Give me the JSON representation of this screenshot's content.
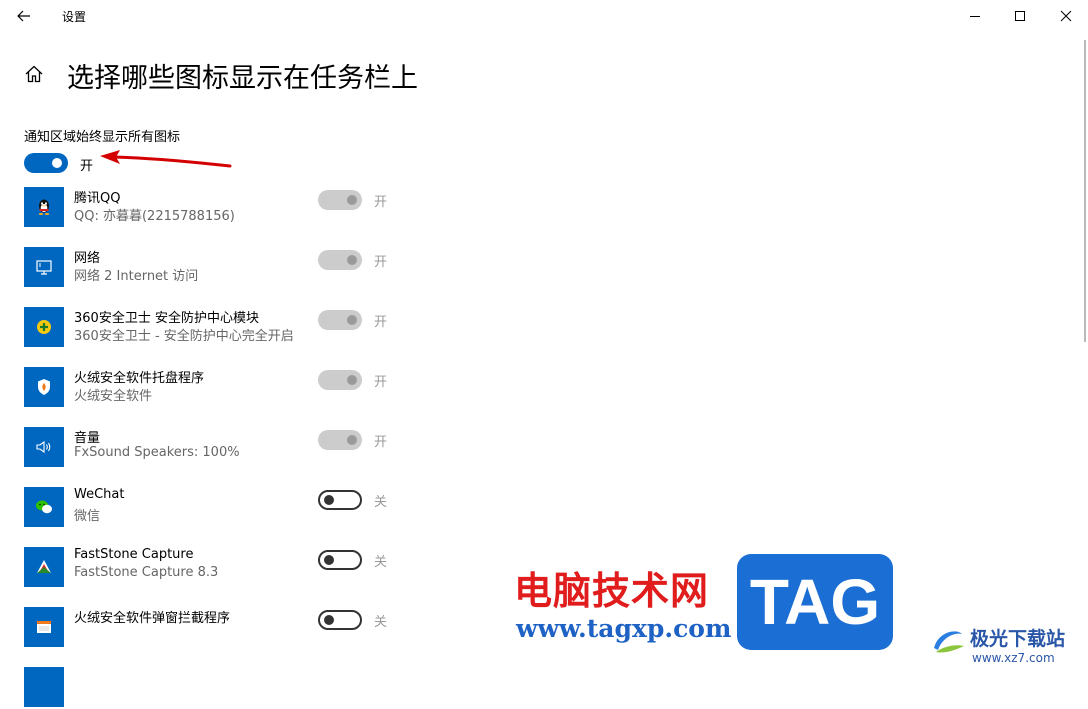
{
  "window": {
    "title": "设置"
  },
  "page": {
    "title": "选择哪些图标显示在任务栏上"
  },
  "master": {
    "label": "通知区域始终显示所有图标",
    "state": "开",
    "on": true
  },
  "apps": [
    {
      "name": "腾讯QQ",
      "desc": "QQ: 亦暮暮(2215788156)",
      "state": "开",
      "on": true,
      "disabled": true,
      "icon": "qq-icon"
    },
    {
      "name": "网络",
      "desc": "网络 2 Internet 访问",
      "state": "开",
      "on": true,
      "disabled": true,
      "icon": "network-icon"
    },
    {
      "name": "360安全卫士 安全防护中心模块",
      "desc": "360安全卫士 - 安全防护中心完全开启",
      "state": "开",
      "on": true,
      "disabled": true,
      "icon": "360-security-icon"
    },
    {
      "name": "火绒安全软件托盘程序",
      "desc": "火绒安全软件",
      "state": "开",
      "on": true,
      "disabled": true,
      "icon": "huorong-shield-icon"
    },
    {
      "name": "音量",
      "desc": "FxSound Speakers: 100%",
      "state": "开",
      "on": true,
      "disabled": true,
      "icon": "volume-icon"
    },
    {
      "name": "WeChat",
      "desc": "微信",
      "state": "关",
      "on": false,
      "disabled": false,
      "icon": "wechat-icon"
    },
    {
      "name": "FastStone Capture",
      "desc": "FastStone Capture 8.3",
      "state": "关",
      "on": false,
      "disabled": false,
      "icon": "faststone-icon"
    },
    {
      "name": "火绒安全软件弹窗拦截程序",
      "desc": "",
      "state": "关",
      "on": false,
      "disabled": false,
      "icon": "popup-blocker-icon"
    }
  ],
  "watermark": {
    "cn": "电脑技术网",
    "url": "www.tagxp.com",
    "tag": "TAG",
    "site_cn": "极光下载站",
    "site_url": "www.xz7.com"
  },
  "colors": {
    "accent": "#0067c0",
    "annotation": "#d40000",
    "watermark_red": "#e01c1c",
    "watermark_blue": "#1b6fd4"
  }
}
